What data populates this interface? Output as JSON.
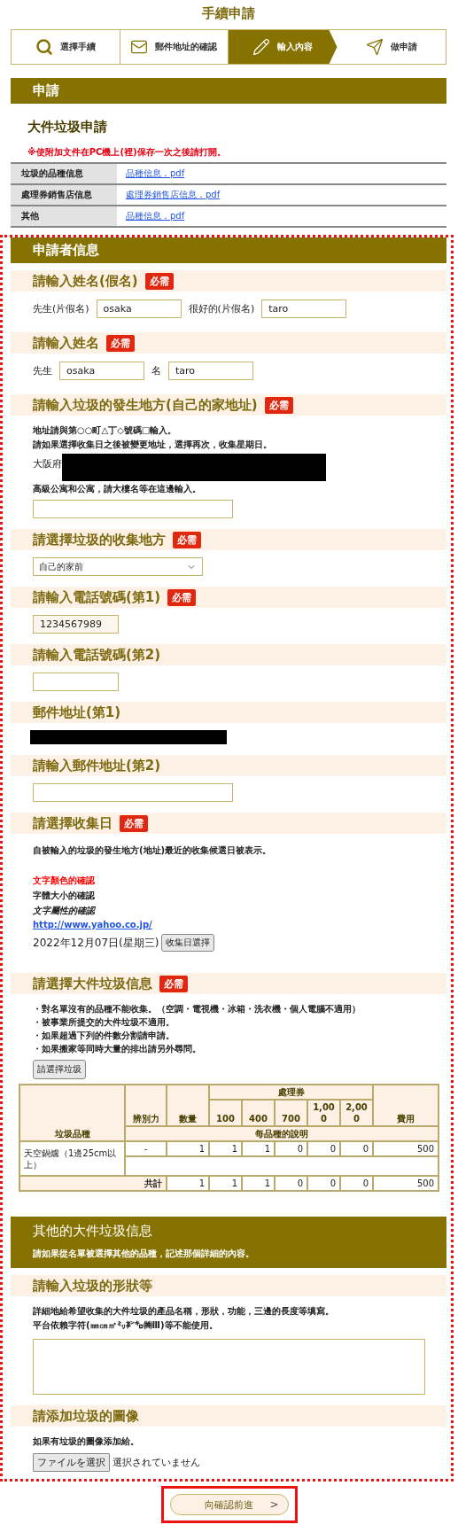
{
  "page_title": "手續申請",
  "steps": [
    {
      "label": "選擇手續",
      "selected": false
    },
    {
      "label": "郵件地址的確認",
      "selected": false
    },
    {
      "label": "輸入內容",
      "selected": true
    },
    {
      "label": "做申請",
      "selected": false
    }
  ],
  "application": {
    "heading": "申請",
    "title": "大件垃圾申請",
    "notice": "※使附加文件在PC機上(裡)保存一次之後請打開。",
    "documents": [
      {
        "label": "垃圾的品種信息",
        "link": "品種信息．pdf"
      },
      {
        "label": "處理券銷售店信息",
        "link": "處理券銷售店信息．pdf"
      },
      {
        "label": "其他",
        "link": "品種信息．pdf"
      }
    ]
  },
  "applicant": {
    "heading": "申請者信息",
    "sections": [
      {
        "kind": "name_pair",
        "title": "請輸入姓名(假名)",
        "badge": "必需",
        "fields": [
          {
            "label": "先生(片假名)",
            "value": "osaka"
          },
          {
            "label": "很好的(片假名)",
            "value": "taro"
          }
        ]
      },
      {
        "kind": "name_pair",
        "title": "請輸入姓名",
        "badge": "必需",
        "fields": [
          {
            "label": "先生",
            "value": "osaka"
          },
          {
            "label": "名",
            "value": "taro"
          }
        ]
      },
      {
        "kind": "address",
        "title": "請輸入垃圾的發生地方(自己的家地址)",
        "badge": "必需",
        "notes": [
          "地址請與第○○町△丁◇號碼□輸入。",
          "請如果選擇收集日之後被變更地址，選擇再次，收集星期日。"
        ],
        "prefecture": "大阪府",
        "note_after": "高級公寓和公寓，請大樓名等在這邊輸入。"
      },
      {
        "kind": "select",
        "title": "請選擇垃圾的收集地方",
        "badge": "必需",
        "value": "自己的家前"
      },
      {
        "kind": "phone",
        "title": "請輸入電話號碼(第1)",
        "badge": "必需",
        "value": "1234567989"
      },
      {
        "kind": "phone",
        "title": "請輸入電話號碼(第2)"
      },
      {
        "kind": "redacted",
        "title": "郵件地址(第1)"
      },
      {
        "kind": "email",
        "title": "請輸入郵件地址(第2)"
      },
      {
        "kind": "date",
        "title": "請選擇收集日",
        "badge": "必需",
        "description": "自被輸入的垃圾的發生地方(地址)最近的收集候選日被表示。",
        "samples": [
          {
            "kind": "colored",
            "text": "文字顏色的確認",
            "color": "#ff0000"
          },
          {
            "kind": "sized",
            "text": "字體大小的確認"
          },
          {
            "kind": "italic",
            "text": "文字屬性的確認"
          },
          {
            "kind": "link",
            "text": "http://www.yahoo.co.jp/"
          }
        ],
        "date": "2022年12月07日(星期三)",
        "button": "收集日選擇"
      },
      {
        "kind": "items",
        "title": "請選擇大件垃圾信息",
        "badge": "必需",
        "bullets": [
          "・對名單沒有的品種不能收集。（空調・電視機・冰箱・洗衣機・個人電腦不適用）",
          "・被事業所提交的大件垃圾不適用。",
          "・如果超過下列的件數分割請申請。",
          "・如果搬家等同時大量的排出請另外尋問。"
        ],
        "button": "請選擇垃圾",
        "table": {
          "name_header": "垃圾品種",
          "columns": [
            "辨別力",
            "數量"
          ],
          "ticket_header": "處理券",
          "tickets": [
            "100",
            "400",
            "700",
            "1,000",
            "2,000"
          ],
          "fee_header": "費用",
          "description_header": "每品種的說明",
          "rows": [
            {
              "name": "天空鍋爐（1邊25cm以上）",
              "values": [
                "-",
                "1",
                "1",
                "1",
                "0",
                "0",
                "0",
                "500"
              ]
            }
          ],
          "total": {
            "label": "共計",
            "values": [
              "1",
              "1",
              "1",
              "0",
              "0",
              "0",
              "500"
            ]
          }
        }
      }
    ]
  },
  "other": {
    "heading": "其他的大件垃圾信息",
    "note": "請如果從名單被選擇其他的品種，記述那個詳細的內容。",
    "sections": [
      {
        "kind": "textarea",
        "title": "請輸入垃圾的形狀等",
        "notes": [
          "詳細地給希望收集的大件垃圾的產品名稱，形狀，功能，三邊的長度等填寫。",
          "平台依賴字符(㎜㎝㎡㍉㌢㌔㈱Ⅲ)等不能使用。"
        ]
      },
      {
        "kind": "file",
        "title": "請添加垃圾的圖像",
        "notes": [
          "如果有垃圾的圖像添加給。"
        ],
        "file_button": "ファイルを選択",
        "file_status": "選択されていません"
      }
    ]
  },
  "submit": "向確認前進",
  "submit_arrow": ">"
}
